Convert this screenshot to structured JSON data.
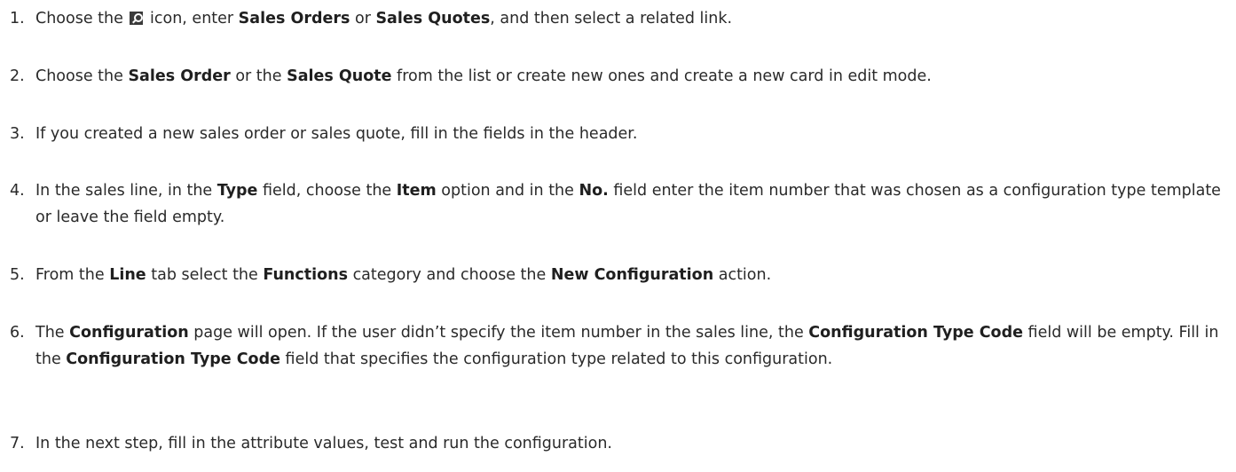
{
  "steps": [
    {
      "num": "1.",
      "parts": [
        "Choose the ",
        "icon",
        " icon, enter ",
        "Sales Orders",
        " or ",
        "Sales Quotes",
        ", and then select a related link."
      ]
    },
    {
      "num": "2.",
      "parts": [
        "Choose the ",
        "Sales Order",
        " or the ",
        "Sales Quote",
        " from the list or create new ones and create a new card in edit mode."
      ]
    },
    {
      "num": "3.",
      "parts": [
        "If you created a new sales order or sales quote, fill in the fields in the header."
      ]
    },
    {
      "num": "4.",
      "parts": [
        "In the sales line, in the ",
        "Type",
        " field, choose the ",
        "Item",
        " option and in the ",
        "No.",
        " field enter the item number that was chosen as a configuration type template or leave the field empty."
      ]
    },
    {
      "num": "5.",
      "parts": [
        "From the ",
        "Line",
        " tab select the ",
        "Functions",
        " category and choose the ",
        "New Configuration",
        " action."
      ]
    },
    {
      "num": "6.",
      "parts": [
        "The ",
        "Configuration",
        " page will open. If the user didn’t specify the item number in the sales line, the ",
        "Configuration Type Code",
        " field will be empty. Fill in the ",
        "Configuration Type Code",
        " field that specifies the configuration type related to this configuration."
      ]
    },
    {
      "num": "7.",
      "parts": [
        "In the next step, fill in the attribute values, test and run the configuration."
      ]
    }
  ],
  "icons": {
    "search": "search-icon"
  }
}
